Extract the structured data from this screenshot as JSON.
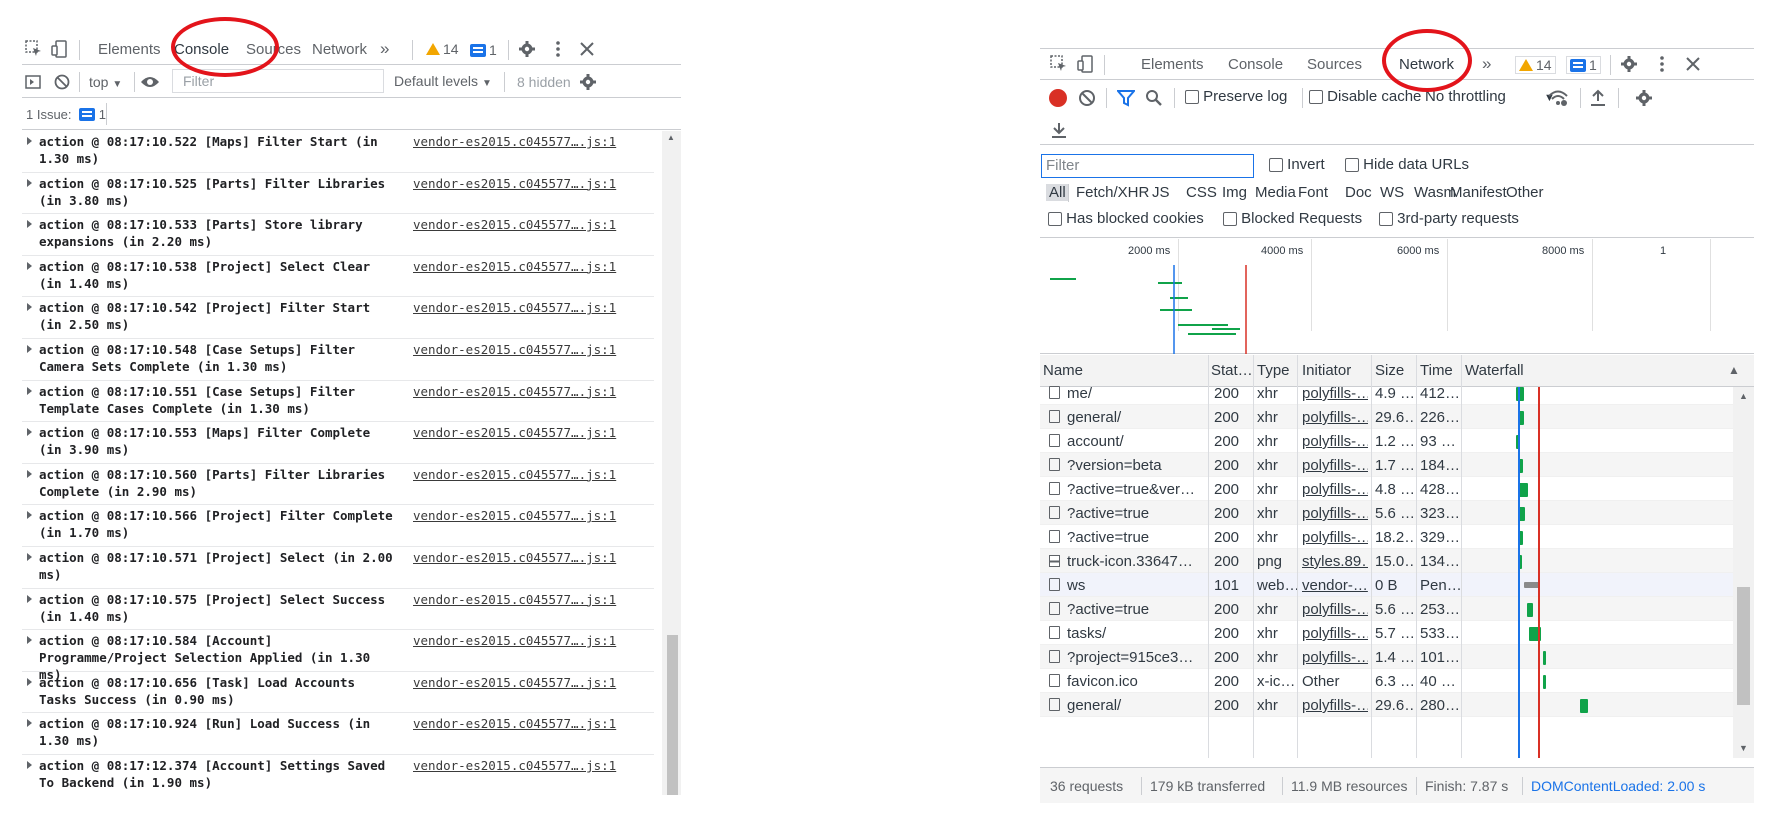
{
  "console_panel": {
    "tabs": [
      "Elements",
      "Console",
      "Sources",
      "Network"
    ],
    "more_tabs": "»",
    "warnings_count": "14",
    "messages_count": "1",
    "toolbar": {
      "context": "top",
      "filter_placeholder": "Filter",
      "levels": "Default levels",
      "hidden": "8 hidden"
    },
    "issues_label": "1 Issue:",
    "issues_count": "1",
    "log": [
      {
        "text": "action @ 08:17:10.522 [Maps] Filter Start (in 1.30 ms)",
        "src": "vendor-es2015.c045577….js:1"
      },
      {
        "text": "action @ 08:17:10.525 [Parts] Filter Libraries (in 3.80 ms)",
        "src": "vendor-es2015.c045577….js:1"
      },
      {
        "text": "action @ 08:17:10.533 [Parts] Store library expansions (in 2.20 ms)",
        "src": "vendor-es2015.c045577….js:1"
      },
      {
        "text": "action @ 08:17:10.538 [Project] Select Clear (in 1.40 ms)",
        "src": "vendor-es2015.c045577….js:1"
      },
      {
        "text": "action @ 08:17:10.542 [Project] Filter Start (in 2.50 ms)",
        "src": "vendor-es2015.c045577….js:1"
      },
      {
        "text": "action @ 08:17:10.548 [Case Setups] Filter Camera Sets Complete (in 1.30 ms)",
        "src": "vendor-es2015.c045577….js:1"
      },
      {
        "text": "action @ 08:17:10.551 [Case Setups] Filter Template Cases Complete (in 1.30 ms)",
        "src": "vendor-es2015.c045577….js:1"
      },
      {
        "text": "action @ 08:17:10.553 [Maps] Filter Complete (in 3.90 ms)",
        "src": "vendor-es2015.c045577….js:1"
      },
      {
        "text": "action @ 08:17:10.560 [Parts] Filter Libraries Complete (in 2.90 ms)",
        "src": "vendor-es2015.c045577….js:1"
      },
      {
        "text": "action @ 08:17:10.566 [Project] Filter Complete (in 1.70 ms)",
        "src": "vendor-es2015.c045577….js:1"
      },
      {
        "text": "action @ 08:17:10.571 [Project] Select (in 2.00 ms)",
        "src": "vendor-es2015.c045577….js:1"
      },
      {
        "text": "action @ 08:17:10.575 [Project] Select Success (in 1.40 ms)",
        "src": "vendor-es2015.c045577….js:1"
      },
      {
        "text": "action @ 08:17:10.584 [Account] Programme/Project Selection Applied (in 1.30 ms)",
        "src": "vendor-es2015.c045577….js:1"
      },
      {
        "text": "action @ 08:17:10.656 [Task] Load Accounts Tasks Success (in 0.90 ms)",
        "src": "vendor-es2015.c045577….js:1"
      },
      {
        "text": "action @ 08:17:10.924 [Run] Load Success (in 1.30 ms)",
        "src": "vendor-es2015.c045577….js:1"
      },
      {
        "text": "action @ 08:17:12.374 [Account] Settings Saved To Backend (in 1.90 ms)",
        "src": "vendor-es2015.c045577….js:1"
      }
    ]
  },
  "network_panel": {
    "tabs": [
      "Elements",
      "Console",
      "Sources",
      "Network"
    ],
    "more_tabs": "»",
    "warnings_count": "14",
    "messages_count": "1",
    "toolbar": {
      "preserve_log": "Preserve log",
      "disable_cache": "Disable cache",
      "throttling": "No throttling"
    },
    "filter_placeholder": "Filter",
    "invert": "Invert",
    "hide_data_urls": "Hide data URLs",
    "type_filters": [
      "All",
      "Fetch/XHR",
      "JS",
      "CSS",
      "Img",
      "Media",
      "Font",
      "Doc",
      "WS",
      "Wasm",
      "Manifest",
      "Other"
    ],
    "blocked_cookies": "Has blocked cookies",
    "blocked_requests": "Blocked Requests",
    "third_party": "3rd-party requests",
    "overview_ticks": [
      "2000 ms",
      "4000 ms",
      "6000 ms",
      "8000 ms",
      "1"
    ],
    "columns": [
      "Name",
      "Stat…",
      "Type",
      "Initiator",
      "Size",
      "Time",
      "Waterfall"
    ],
    "rows": [
      {
        "name": "me/",
        "status": "200",
        "type": "xhr",
        "initiator": "polyfills-…",
        "size": "4.9 …",
        "time": "412…",
        "wf_start": 0.19,
        "wf_len": 0.03
      },
      {
        "name": "general/",
        "status": "200",
        "type": "xhr",
        "initiator": "polyfills-…",
        "size": "29.6…",
        "time": "226…",
        "wf_start": 0.2,
        "wf_len": 0.02
      },
      {
        "name": "account/",
        "status": "200",
        "type": "xhr",
        "initiator": "polyfills-…",
        "size": "1.2 …",
        "time": "93 …",
        "wf_start": 0.19,
        "wf_len": 0.01
      },
      {
        "name": "?version=beta",
        "status": "200",
        "type": "xhr",
        "initiator": "polyfills-…",
        "size": "1.7 …",
        "time": "184…",
        "wf_start": 0.2,
        "wf_len": 0.015
      },
      {
        "name": "?active=true&ver…",
        "status": "200",
        "type": "xhr",
        "initiator": "polyfills-…",
        "size": "4.8 …",
        "time": "428…",
        "wf_start": 0.2,
        "wf_len": 0.035
      },
      {
        "name": "?active=true",
        "status": "200",
        "type": "xhr",
        "initiator": "polyfills-…",
        "size": "5.6 …",
        "time": "323…",
        "wf_start": 0.2,
        "wf_len": 0.025
      },
      {
        "name": "?active=true",
        "status": "200",
        "type": "xhr",
        "initiator": "polyfills-…",
        "size": "18.2…",
        "time": "329…",
        "wf_start": 0.2,
        "wf_len": 0.015
      },
      {
        "name": "truck-icon.33647…",
        "status": "200",
        "type": "png",
        "initiator": "styles.89…",
        "size": "15.0…",
        "time": "134…",
        "wf_start": 0.2,
        "wf_len": 0.01
      },
      {
        "name": "ws",
        "status": "101",
        "type": "web…",
        "initiator": "vendor-…",
        "size": "0 B",
        "time": "Pen…",
        "wf_start": 0.22,
        "wf_len": 0.06
      },
      {
        "name": "?active=true",
        "status": "200",
        "type": "xhr",
        "initiator": "polyfills-…",
        "size": "5.6 …",
        "time": "253…",
        "wf_start": 0.23,
        "wf_len": 0.025
      },
      {
        "name": "tasks/",
        "status": "200",
        "type": "xhr",
        "initiator": "polyfills-…",
        "size": "5.7 …",
        "time": "533…",
        "wf_start": 0.24,
        "wf_len": 0.045
      },
      {
        "name": "?project=915ce3…",
        "status": "200",
        "type": "xhr",
        "initiator": "polyfills-…",
        "size": "1.4 …",
        "time": "101…",
        "wf_start": 0.29,
        "wf_len": 0.01
      },
      {
        "name": "favicon.ico",
        "status": "200",
        "type": "x-ic…",
        "initiator": "Other",
        "size": "6.3 …",
        "time": "40 …",
        "wf_start": 0.29,
        "wf_len": 0.008
      },
      {
        "name": "general/",
        "status": "200",
        "type": "xhr",
        "initiator": "polyfills-…",
        "size": "29.6…",
        "time": "280…",
        "wf_start": 0.43,
        "wf_len": 0.03
      }
    ],
    "status_bar": {
      "requests": "36 requests",
      "transferred": "179 kB transferred",
      "resources": "11.9 MB resources",
      "finish": "Finish: 7.87 s",
      "dcl": "DOMContentLoaded: 2.00 s"
    },
    "colors": {
      "accent": "#1a73e8",
      "waterfall_bar": "#10a34a",
      "annotation_circle": "#e3141b"
    }
  }
}
